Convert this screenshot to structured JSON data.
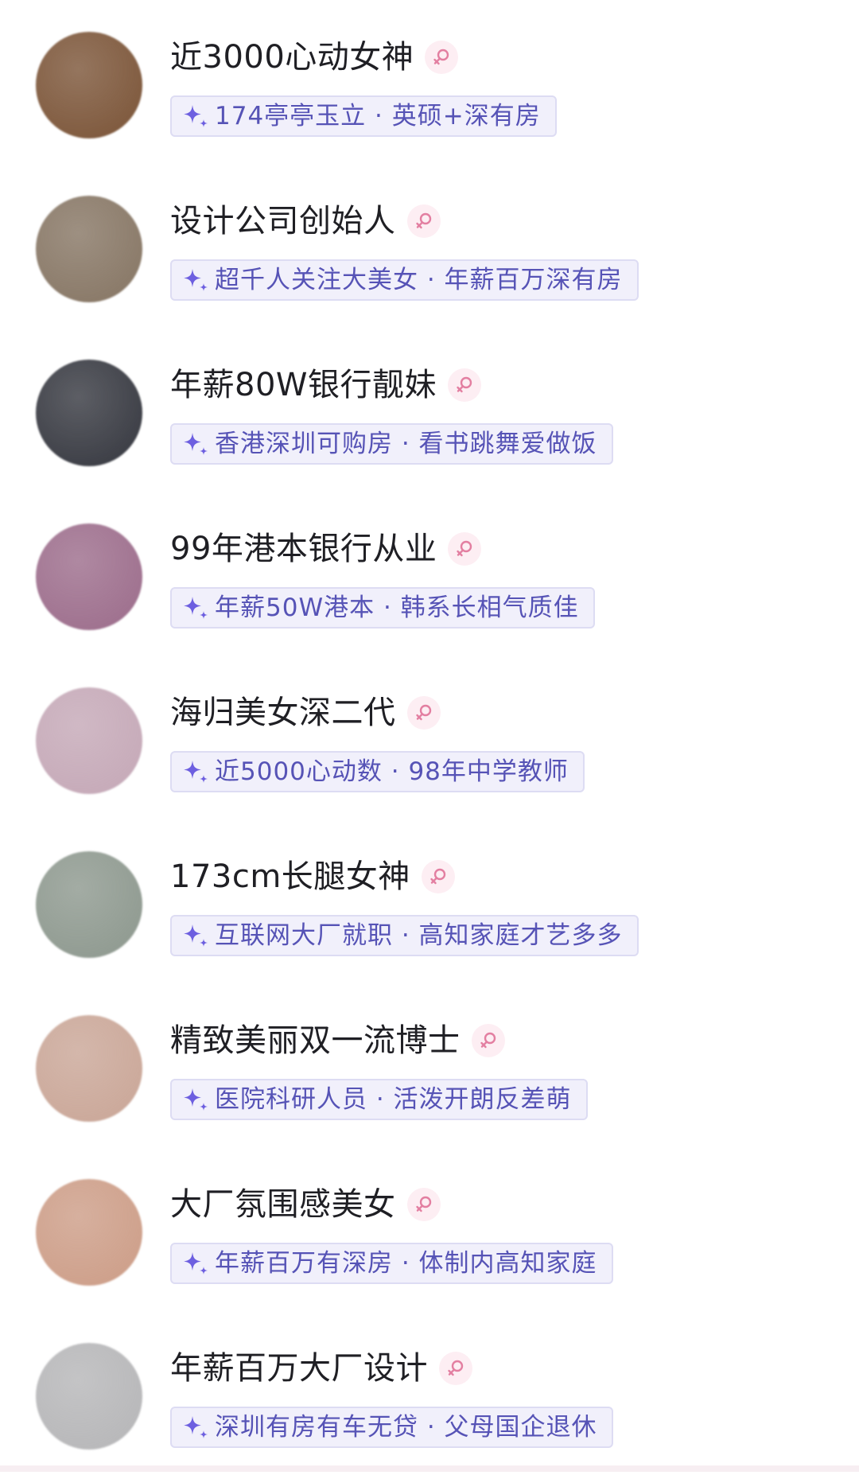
{
  "colors": {
    "name_text": "#1f1f24",
    "tag_text": "#5653b6",
    "tag_bg": "#f1f0fb",
    "tag_border": "#dddcf3",
    "sparkle": "#6d5fe0",
    "gender_bg": "#fdeef3",
    "gender_icon": "#e37fa1"
  },
  "icons": {
    "tag_icon": "sparkle-icon",
    "gender_icon": "female-symbol-icon"
  },
  "profiles": [
    {
      "name": "近3000心动女神",
      "tag": "174亭亭玉立 · 英硕+深有房",
      "avatar_color": "#7a5336"
    },
    {
      "name": "设计公司创始人",
      "tag": "超千人关注大美女 · 年薪百万深有房",
      "avatar_color": "#857462"
    },
    {
      "name": "年薪80W银行靓妹",
      "tag": "香港深圳可购房 · 看书跳舞爱做饭",
      "avatar_color": "#34363e"
    },
    {
      "name": "99年港本银行从业",
      "tag": "年薪50W港本 · 韩系长相气质佳",
      "avatar_color": "#9b6b8a"
    },
    {
      "name": "海归美女深二代",
      "tag": "近5000心动数 · 98年中学教师",
      "avatar_color": "#c4a7b6"
    },
    {
      "name": "173cm长腿女神",
      "tag": "互联网大厂就职 · 高知家庭才艺多多",
      "avatar_color": "#8c978d"
    },
    {
      "name": "精致美丽双一流博士",
      "tag": "医院科研人员 · 活泼开朗反差萌",
      "avatar_color": "#c9a596"
    },
    {
      "name": "大厂氛围感美女",
      "tag": "年薪百万有深房 · 体制内高知家庭",
      "avatar_color": "#cc9c86"
    },
    {
      "name": "年薪百万大厂设计",
      "tag": "深圳有房有车无贷 · 父母国企退休",
      "avatar_color": "#b5b5b7"
    }
  ]
}
